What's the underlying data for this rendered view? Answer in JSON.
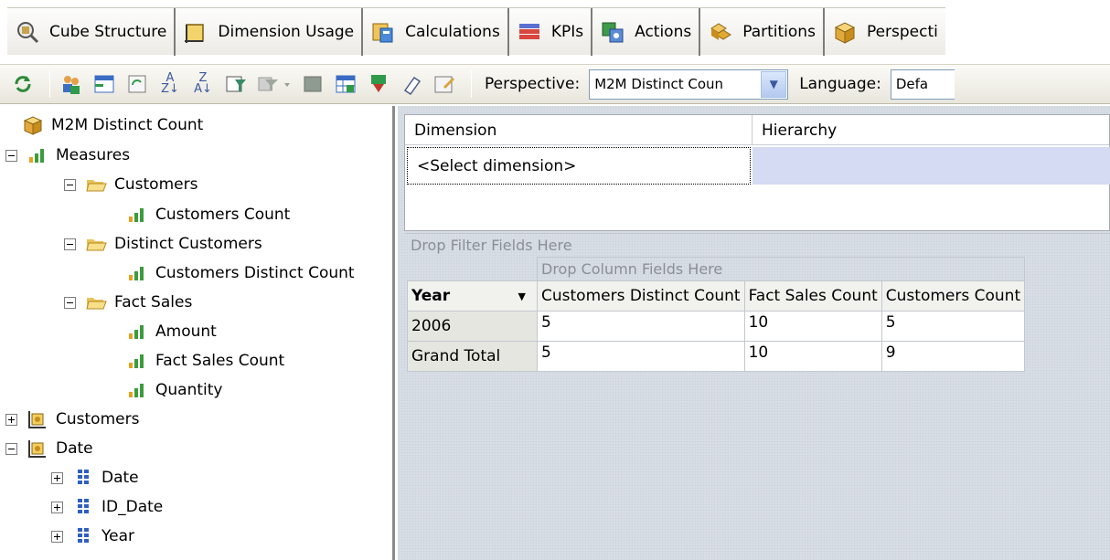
{
  "tabs": [
    {
      "label": "Cube Structure",
      "icon": "cube-structure-icon"
    },
    {
      "label": "Dimension Usage",
      "icon": "dimension-usage-icon"
    },
    {
      "label": "Calculations",
      "icon": "calculations-icon"
    },
    {
      "label": "KPIs",
      "icon": "kpis-icon"
    },
    {
      "label": "Actions",
      "icon": "actions-icon"
    },
    {
      "label": "Partitions",
      "icon": "partitions-icon"
    },
    {
      "label": "Perspecti",
      "icon": "perspectives-icon"
    }
  ],
  "toolbar": {
    "perspective_label": "Perspective:",
    "perspective_value": "M2M Distinct Coun",
    "language_label": "Language:",
    "language_value": "Defa"
  },
  "tree": {
    "root": "M2M Distinct Count",
    "measures": "Measures",
    "customers_group": "Customers",
    "customers_count": "Customers Count",
    "distinct_customers_group": "Distinct Customers",
    "customers_distinct_count": "Customers Distinct Count",
    "fact_sales_group": "Fact Sales",
    "amount": "Amount",
    "fact_sales_count": "Fact Sales Count",
    "quantity": "Quantity",
    "customers_dim": "Customers",
    "date_dim": "Date",
    "date_attr": "Date",
    "id_date_attr": "ID_Date",
    "year_attr": "Year"
  },
  "filter_pane": {
    "col_dimension": "Dimension",
    "col_hierarchy": "Hierarchy",
    "select_dimension": "<Select dimension>"
  },
  "pivot": {
    "drop_filter": "Drop Filter Fields Here",
    "drop_column": "Drop Column Fields Here",
    "row_field": "Year",
    "columns": [
      "Customers Distinct Count",
      "Fact Sales Count",
      "Customers Count"
    ],
    "rows": [
      {
        "label": "2006",
        "values": [
          "5",
          "10",
          "5"
        ]
      },
      {
        "label": "Grand Total",
        "values": [
          "5",
          "10",
          "9"
        ]
      }
    ]
  },
  "colors": {
    "tab_separator": "#7c7c7c",
    "hierarchy_cell": "#d5dbf2",
    "pivot_background": "#d9dee6",
    "drop_zone_text": "#8a8f96"
  }
}
